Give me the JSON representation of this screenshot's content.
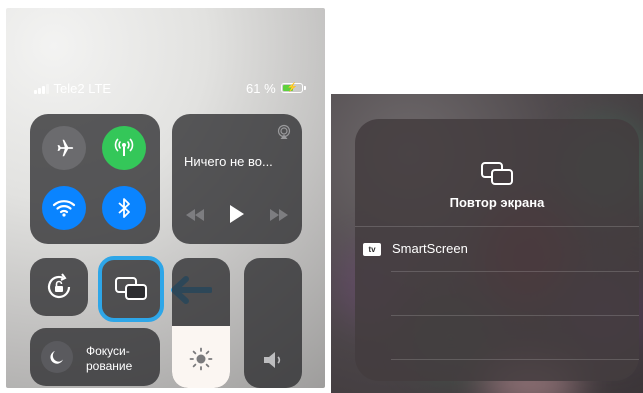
{
  "status_bar": {
    "carrier": "Tele2 LTE",
    "battery": "61 %",
    "battery_level": 0.61
  },
  "connectivity": {
    "airplane": "airplane-icon",
    "cellular": "cellular-antenna-icon",
    "wifi": "wifi-icon",
    "bluetooth": "bluetooth-icon"
  },
  "media": {
    "title": "Ничего не во..."
  },
  "brightness_level": 0.48,
  "focus": {
    "label": "Фокуси-\nрование"
  },
  "mirroring": {
    "title": "Повтор экрана",
    "device_badge": "tv",
    "device_name": "SmartScreen"
  },
  "colors": {
    "green": "#34c759",
    "blue": "#0a84ff",
    "highlight": "#2ea6e8"
  }
}
